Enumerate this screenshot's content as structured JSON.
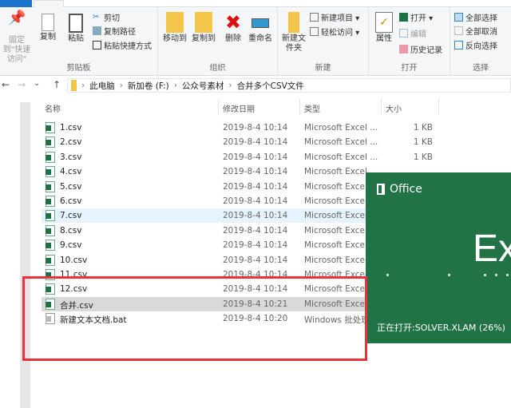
{
  "ribbon": {
    "clipboard": {
      "label": "剪贴板",
      "pin": "固定到\"快速访问\"",
      "copy": "复制",
      "paste": "粘贴",
      "cut": "剪切",
      "copy_path": "复制路径",
      "paste_shortcut": "粘贴快捷方式"
    },
    "organize": {
      "label": "组织",
      "move_to": "移动到",
      "copy_to": "复制到",
      "delete": "删除",
      "rename": "重命名"
    },
    "new": {
      "label": "新建",
      "new_folder": "新建文件夹",
      "new_item": "新建项目 ▾",
      "easy_access": "轻松访问 ▾"
    },
    "open": {
      "label": "打开",
      "properties": "属性",
      "open": "打开 ▾",
      "edit": "编辑",
      "history": "历史记录"
    },
    "select": {
      "label": "选择",
      "select_all": "全部选择",
      "select_none": "全部取消",
      "invert": "反向选择"
    }
  },
  "address": {
    "back": "←",
    "forward": "→",
    "recent": "⌄",
    "up": "↑",
    "crumbs": [
      "此电脑",
      "新加卷 (F:)",
      "公众号素材",
      "合并多个CSV文件"
    ]
  },
  "columns": {
    "name": "名称",
    "date": "修改日期",
    "type": "类型",
    "size": "大小"
  },
  "files": [
    {
      "name": "1.csv",
      "date": "2019-8-4 10:14",
      "type": "Microsoft Excel ...",
      "size": "1 KB"
    },
    {
      "name": "2.csv",
      "date": "2019-8-4 10:14",
      "type": "Microsoft Excel ...",
      "size": "1 KB"
    },
    {
      "name": "3.csv",
      "date": "2019-8-4 10:14",
      "type": "Microsoft Excel ...",
      "size": "1 KB"
    },
    {
      "name": "4.csv",
      "date": "2019-8-4 10:14",
      "type": "Microsoft Excel",
      "size": ""
    },
    {
      "name": "5.csv",
      "date": "2019-8-4 10:14",
      "type": "Microsoft Excel",
      "size": ""
    },
    {
      "name": "6.csv",
      "date": "2019-8-4 10:14",
      "type": "Microsoft Excel",
      "size": ""
    },
    {
      "name": "7.csv",
      "date": "2019-8-4 10:14",
      "type": "Microsoft Excel",
      "size": ""
    },
    {
      "name": "8.csv",
      "date": "2019-8-4 10:14",
      "type": "Microsoft Excel",
      "size": ""
    },
    {
      "name": "9.csv",
      "date": "2019-8-4 10:14",
      "type": "Microsoft Excel",
      "size": ""
    },
    {
      "name": "10.csv",
      "date": "2019-8-4 10:14",
      "type": "Microsoft Excel",
      "size": ""
    },
    {
      "name": "11.csv",
      "date": "2019-8-4 10:14",
      "type": "Microsoft Excel",
      "size": ""
    },
    {
      "name": "12.csv",
      "date": "2019-8-4 10:14",
      "type": "Microsoft Exce",
      "size": ""
    },
    {
      "name": "合并.csv",
      "date": "2019-8-4 10:21",
      "type": "Microsoft Exce",
      "size": ""
    },
    {
      "name": "新建文本文档.bat",
      "date": "2019-8-4 10:20",
      "type": "Windows 批处理",
      "size": ""
    }
  ],
  "splash": {
    "brand": "Office",
    "app": "Ex",
    "status": "正在打开:SOLVER.XLAM (26%)",
    "progress_percent": 26,
    "color": "#217346"
  },
  "colors": {
    "highlight": "#e8323c",
    "selected_row": "#d9d9d9",
    "hover_row": "#e5f3ff"
  }
}
